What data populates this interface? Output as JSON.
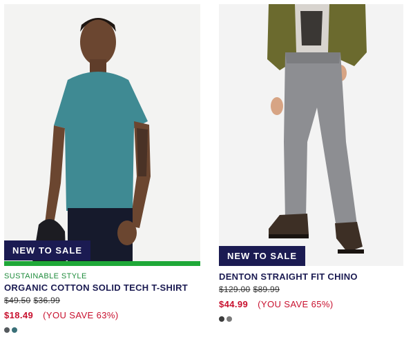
{
  "products": [
    {
      "badge": "NEW TO SALE",
      "eyebrow": "SUSTAINABLE STYLE",
      "title": "ORGANIC COTTON SOLID TECH T-SHIRT",
      "was_prices": [
        "$49.50",
        "$36.99"
      ],
      "price": "$18.49",
      "save": "(YOU SAVE 63%)",
      "swatch_colors": [
        "#555a5e",
        "#3a7078"
      ],
      "image": "man-in-teal-tshirt-photo"
    },
    {
      "badge": "NEW TO SALE",
      "title": "DENTON STRAIGHT FIT CHINO",
      "was_prices": [
        "$129.00",
        "$89.99"
      ],
      "price": "$44.99",
      "save": "(YOU SAVE 65%)",
      "swatch_colors": [
        "#3c3c3c",
        "#7a7a7a"
      ],
      "image": "grey-chino-pants-photo"
    }
  ],
  "colors": {
    "badge_bg": "#1b1b52",
    "sustainable_bar": "#1fa838",
    "sale_red": "#c8102e"
  }
}
